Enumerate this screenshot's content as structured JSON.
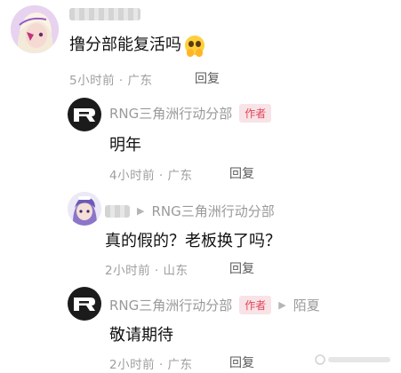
{
  "comments": [
    {
      "text": "撸分部能复活吗",
      "time": "5小时前",
      "location": "广东",
      "reply_label": "回复"
    },
    {
      "username": "RNG三角洲行动分部",
      "badge": "作者",
      "text": "明年",
      "time": "4小时前",
      "location": "广东",
      "reply_label": "回复"
    },
    {
      "reply_target": "RNG三角洲行动分部",
      "text": "真的假的？老板换了吗？",
      "time": "2小时前",
      "location": "山东",
      "reply_label": "回复"
    },
    {
      "username": "RNG三角洲行动分部",
      "badge": "作者",
      "reply_target": "陌夏",
      "text": "敬请期待",
      "time": "2小时前",
      "location": "广东",
      "reply_label": "回复"
    }
  ],
  "colors": {
    "badge_bg": "#f8e3e6",
    "badge_text": "#e0465b",
    "meta_gray": "#9e9e9e"
  },
  "icons": [
    "rng-logo-icon",
    "arrow-right-icon",
    "pleading-emoji-icon"
  ]
}
